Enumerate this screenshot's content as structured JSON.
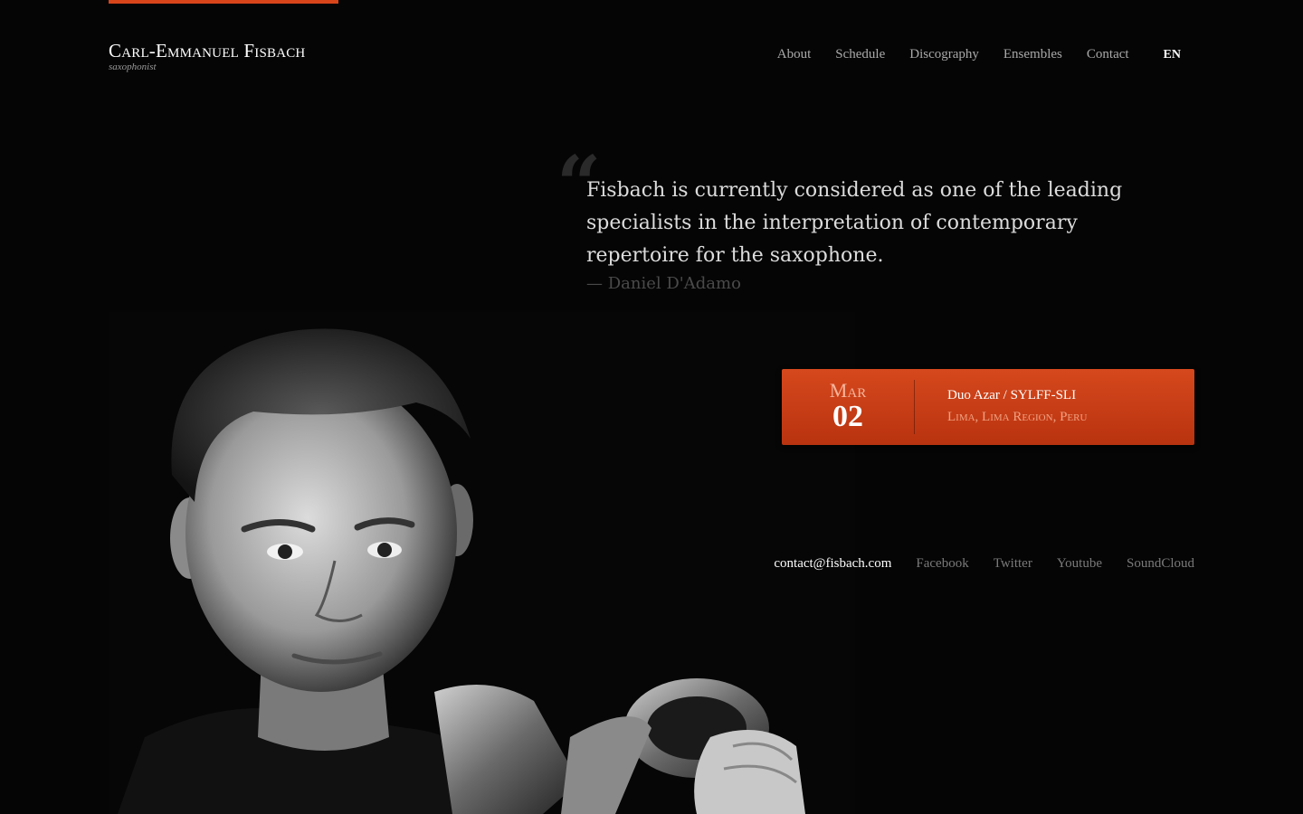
{
  "brand": {
    "name": "Carl-Emmanuel Fisbach",
    "subtitle": "saxophonist"
  },
  "nav": {
    "items": [
      {
        "label": "About"
      },
      {
        "label": "Schedule"
      },
      {
        "label": "Discography"
      },
      {
        "label": "Ensembles"
      },
      {
        "label": "Contact"
      }
    ],
    "language": "EN"
  },
  "quote": {
    "mark": "“",
    "text": "Fisbach is currently considered as one of the leading specialists in the interpretation of contemporary repertoire for the saxophone.",
    "author": "— Daniel D'Adamo"
  },
  "event": {
    "month": "Mar",
    "day": "02",
    "title": "Duo Azar / SYLFF-SLI",
    "location": "Lima, Lima Region, Peru"
  },
  "contact": {
    "email": "contact@fisbach.com",
    "social": [
      "Facebook",
      "Twitter",
      "Youtube",
      "SoundCloud"
    ]
  },
  "colors": {
    "accent": "#d9451b",
    "background": "#050505"
  }
}
